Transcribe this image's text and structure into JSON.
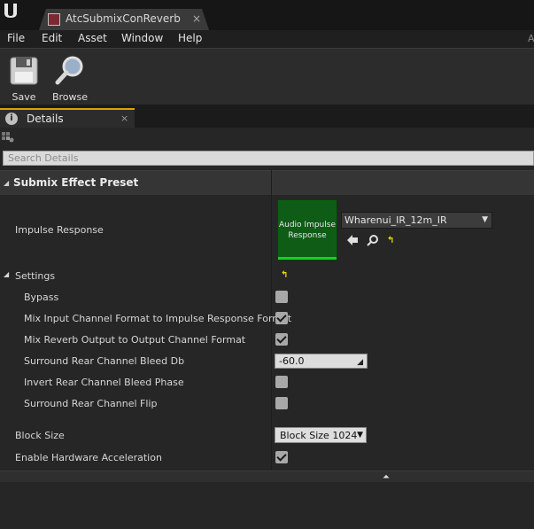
{
  "window": {
    "tab_title": "AtcSubmixConReverb",
    "tab_close": "×"
  },
  "menu": {
    "items": [
      "File",
      "Edit",
      "Asset",
      "Window",
      "Help"
    ],
    "right_glyph": "A"
  },
  "toolbar": {
    "save_label": "Save",
    "browse_label": "Browse"
  },
  "panel": {
    "tab_title": "Details",
    "tab_close": "×"
  },
  "search": {
    "placeholder": "Search Details"
  },
  "category": {
    "title": "Submix Effect Preset"
  },
  "impulse": {
    "label": "Impulse Response",
    "thumbnail_text": "Audio Impulse Response",
    "asset_name": "Wharenui_IR_12m_IR"
  },
  "settings": {
    "label": "Settings",
    "bypass": {
      "label": "Bypass",
      "checked": false
    },
    "mix_input": {
      "label": "Mix Input Channel Format to Impulse Response Format",
      "checked": true
    },
    "mix_reverb": {
      "label": "Mix Reverb Output to Output Channel Format",
      "checked": true
    },
    "surround_bleed": {
      "label": "Surround Rear Channel Bleed Db",
      "value": "-60.0"
    },
    "invert_bleed": {
      "label": "Invert Rear Channel Bleed Phase",
      "checked": false
    },
    "surround_flip": {
      "label": "Surround Rear Channel Flip",
      "checked": false
    }
  },
  "block_size": {
    "label": "Block Size",
    "value": "Block Size 1024"
  },
  "hw_accel": {
    "label": "Enable Hardware Acceleration",
    "checked": true
  },
  "colors": {
    "accent_tab": "#e0a000",
    "thumbnail_bg": "#0f5c17",
    "thumbnail_bar": "#12d41e",
    "reset_arrow": "#e8e000"
  }
}
